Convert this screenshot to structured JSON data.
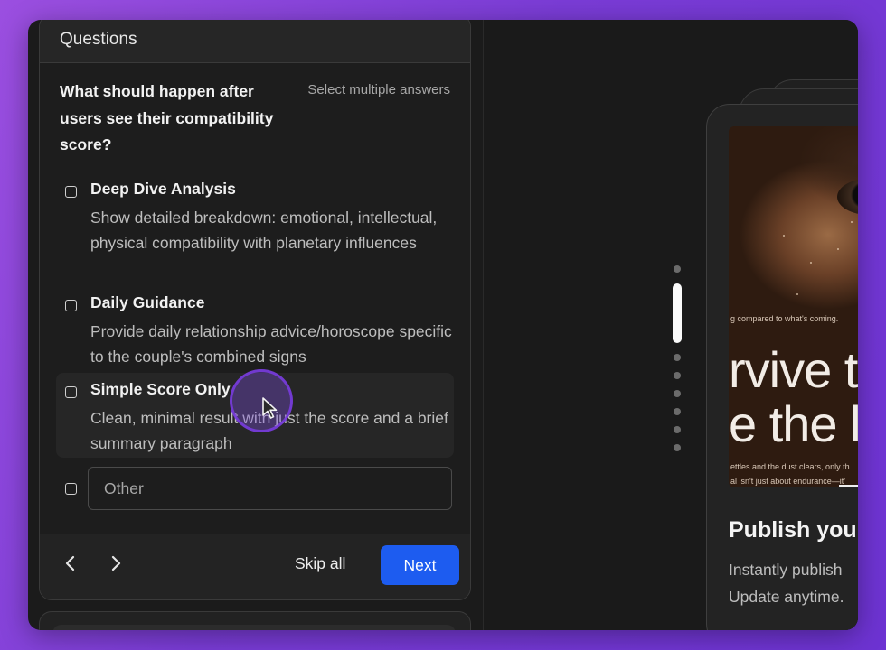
{
  "panel": {
    "title": "Questions",
    "question": "What should happen after users see their compatibility score?",
    "hint": "Select multiple answers",
    "options": [
      {
        "title": "Deep Dive Analysis",
        "description": "Show detailed breakdown: emotional, intellectual, physical compatibility with planetary influences"
      },
      {
        "title": "Daily Guidance",
        "description": "Provide daily relationship advice/horoscope specific to the couple's combined signs"
      },
      {
        "title": "Simple Score Only",
        "description": "Clean, minimal result with just the score and a brief summary paragraph"
      }
    ],
    "other_placeholder": "Other",
    "footer": {
      "skip_label": "Skip all",
      "next_label": "Next"
    }
  },
  "preview": {
    "small_text_top": "g compared to what's coming.",
    "big_line_1": "rvive th",
    "big_line_2": "e the l",
    "small_text_bottom_1": "ettles and the dust clears, only th",
    "small_text_bottom_2": "al isn't just about endurance—it'",
    "publish_title": "Publish you",
    "publish_desc_1": "Instantly publish",
    "publish_desc_2": "Update anytime."
  },
  "colors": {
    "accent": "#1d5cf0",
    "background_gradient": [
      "#9b4fe0",
      "#6d33d2"
    ],
    "cursor_ring": "#7a3cdc"
  },
  "icons": [
    "checkbox-icon",
    "chevron-left-icon",
    "chevron-right-icon",
    "mouse-pointer-icon"
  ]
}
